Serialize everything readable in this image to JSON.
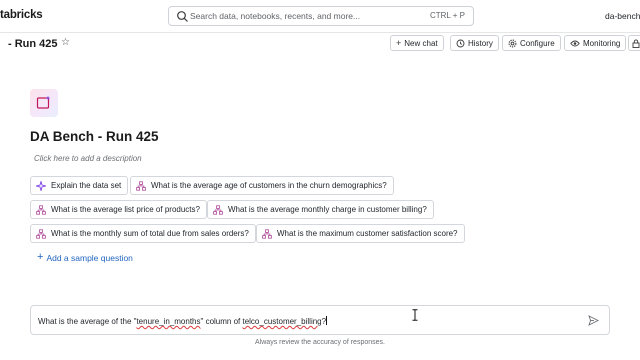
{
  "topbar": {
    "brand": "tabricks",
    "search_placeholder": "Search data, notebooks, recents, and more...",
    "search_shortcut": "CTRL + P",
    "user": "da-bench"
  },
  "header": {
    "title": "- Run 425",
    "buttons": {
      "new_chat": "New chat",
      "history": "History",
      "configure": "Configure",
      "monitoring": "Monitoring"
    }
  },
  "space": {
    "title": "DA Bench - Run 425",
    "description_placeholder": "Click here to add a description"
  },
  "samples": [
    {
      "label": "Explain the data set",
      "icon": "sparkle-icon"
    },
    {
      "label": "What is the average age of customers in the churn demographics?",
      "icon": "flow-icon"
    },
    {
      "label": "What is the average list price of products?",
      "icon": "flow-icon"
    },
    {
      "label": "What is the average monthly charge in customer billing?",
      "icon": "flow-icon"
    },
    {
      "label": "What is the monthly sum of total due from sales orders?",
      "icon": "flow-icon"
    },
    {
      "label": "What is the maximum customer satisfaction score?",
      "icon": "flow-icon"
    }
  ],
  "add_sample_label": "Add a sample question",
  "composer": {
    "text_before": "What is the average of the \"",
    "text_col": "tenure_in_months",
    "text_mid": "\" column of ",
    "text_table": "telco_customer_billing",
    "text_end": "?"
  },
  "footnote": "Always review the accuracy of responses.",
  "colors": {
    "accent": "#2266c0",
    "border": "#d3d7db",
    "spellcheck": "#d93a3a"
  }
}
